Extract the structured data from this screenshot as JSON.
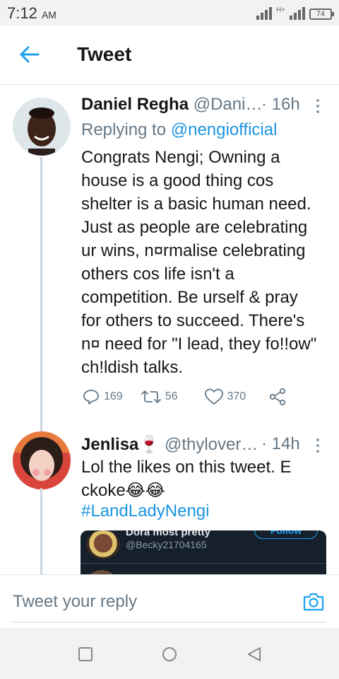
{
  "status_bar": {
    "time": "7:12",
    "ampm": "AM",
    "network": "H+",
    "battery": "74"
  },
  "header": {
    "title": "Tweet"
  },
  "tweets": [
    {
      "name": "Daniel Regha",
      "handle": "@Dani…",
      "time": "· 16h",
      "replying_prefix": "Replying to",
      "replying_to": "@nengiofficial",
      "text": "Congrats Nengi; Owning a\nhouse is a good thing cos\nshelter is a basic human need.\nJust as people are celebrating\nur wins, n¤rmalise celebrating\nothers cos life isn't a\ncompetition. Be urself & pray\nfor others to succeed. There's\nn¤ need for \"I lead, they fo!!ow\"\nch!ldish talks.",
      "replies": "169",
      "retweets": "56",
      "likes": "370"
    },
    {
      "name": "Jenlisa",
      "name_emoji": "🍷",
      "handle": "@thylover…",
      "time": "· 14h",
      "text": "Lol the likes on this tweet. E\nckoke😂😂",
      "hashtag": "#LandLadyNengi",
      "embed": {
        "name": "Dora most pretty",
        "handle": "@Becky21704165",
        "follow_label": "Follow"
      }
    }
  ],
  "reply_bar": {
    "placeholder": "Tweet your reply"
  },
  "icons": {
    "back": "arrow-left-icon",
    "more": "more-vertical-icon",
    "reply": "reply-icon",
    "retweet": "retweet-icon",
    "like": "heart-icon",
    "share": "share-icon",
    "camera": "camera-icon",
    "nav_recent": "square-icon",
    "nav_home": "circle-icon",
    "nav_back": "triangle-back-icon"
  },
  "colors": {
    "accent": "#1b95e0",
    "secondary_text": "#657786"
  }
}
